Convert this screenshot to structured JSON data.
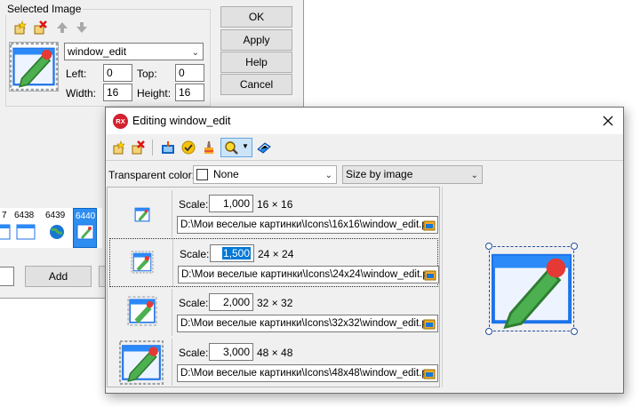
{
  "selected_image_dialog": {
    "group_label": "Selected Image",
    "image_name": "window_edit",
    "left_label": "Left:",
    "left_value": "0",
    "top_label": "Top:",
    "top_value": "0",
    "width_label": "Width:",
    "width_value": "16",
    "height_label": "Height:",
    "height_value": "16",
    "buttons": {
      "ok": "OK",
      "apply": "Apply",
      "help": "Help",
      "cancel": "Cancel"
    },
    "thumbnails": [
      "7",
      "6438",
      "6439",
      "6440"
    ],
    "add_label": "Add"
  },
  "editing_dialog": {
    "title": "Editing window_edit",
    "app_badge": "RX",
    "transparent_label": "Transparent color:",
    "transparent_value": "None",
    "size_mode": "Size by image",
    "rows": [
      {
        "scale_label": "Scale:",
        "scale": "1,000",
        "dims": "16 × 16",
        "path": "D:\\Мои веселые картинки\\Icons\\16x16\\window_edit.pr"
      },
      {
        "scale_label": "Scale:",
        "scale": "1,500",
        "dims": "24 × 24",
        "path": "D:\\Мои веселые картинки\\Icons\\24x24\\window_edit.pr"
      },
      {
        "scale_label": "Scale:",
        "scale": "2,000",
        "dims": "32 × 32",
        "path": "D:\\Мои веселые картинки\\Icons\\32x32\\window_edit.pr"
      },
      {
        "scale_label": "Scale:",
        "scale": "3,000",
        "dims": "48 × 48",
        "path": "D:\\Мои веселые картинки\\Icons\\48x48\\window_edit.pr"
      }
    ],
    "selected_row": 1
  },
  "colors": {
    "accent": "#0078d7",
    "app_badge": "#d3212d"
  },
  "icons": [
    "new-icon",
    "delete-icon",
    "move-up-icon",
    "move-down-icon",
    "window-edit-icon",
    "import-icon",
    "check-icon",
    "clear-icon",
    "zoom-icon",
    "book-icon",
    "close-icon"
  ]
}
